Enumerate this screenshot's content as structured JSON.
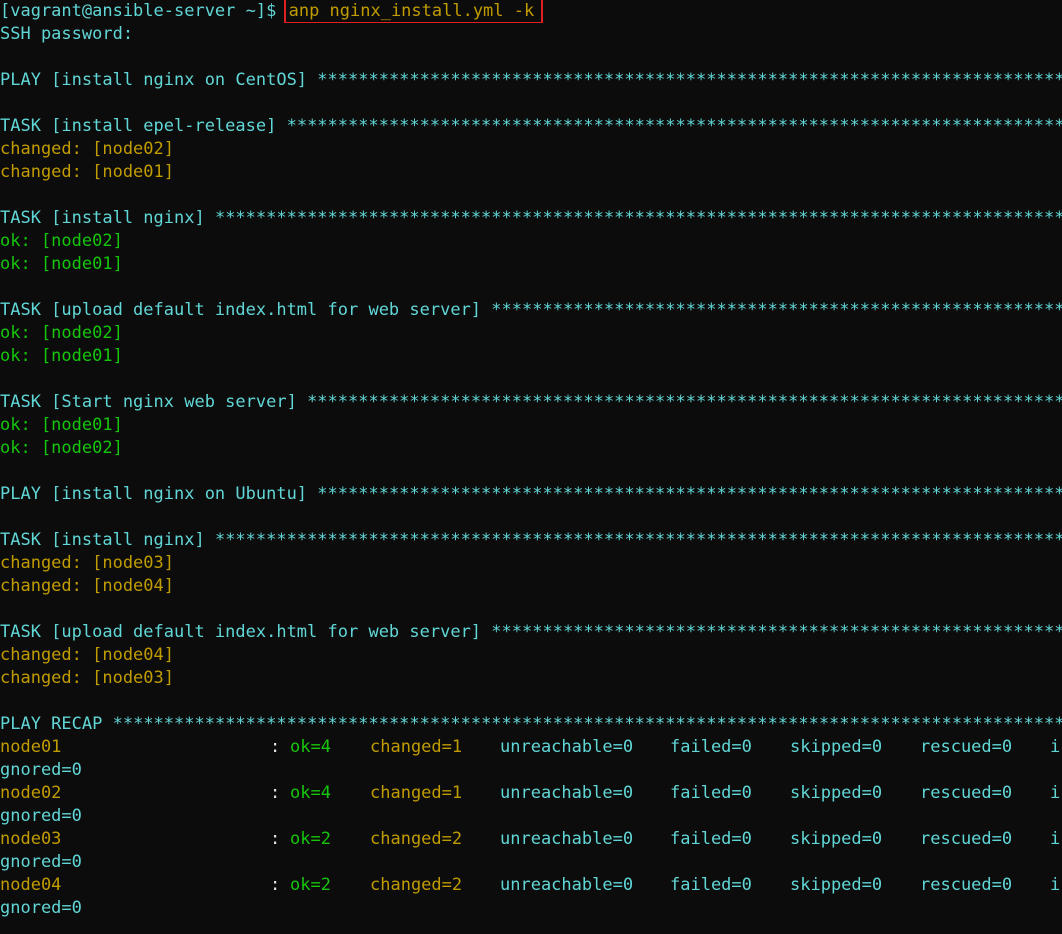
{
  "prompt": {
    "user_host": "[vagrant@ansible-server ~]$",
    "command": "anp nginx_install.yml -k"
  },
  "ssh_password": "SSH password:",
  "stars": "********************************************************************************************************",
  "plays": [
    {
      "header": "PLAY [install nginx on CentOS]",
      "tasks": [
        {
          "header": "TASK [install epel-release]",
          "results": [
            {
              "status": "changed: [node02]",
              "color": "yellow"
            },
            {
              "status": "changed: [node01]",
              "color": "yellow"
            }
          ]
        },
        {
          "header": "TASK [install nginx]",
          "results": [
            {
              "status": "ok: [node02]",
              "color": "green"
            },
            {
              "status": "ok: [node01]",
              "color": "green"
            }
          ]
        },
        {
          "header": "TASK [upload default index.html for web server]",
          "results": [
            {
              "status": "ok: [node02]",
              "color": "green"
            },
            {
              "status": "ok: [node01]",
              "color": "green"
            }
          ]
        },
        {
          "header": "TASK [Start nginx web server]",
          "results": [
            {
              "status": "ok: [node01]",
              "color": "green"
            },
            {
              "status": "ok: [node02]",
              "color": "green"
            }
          ]
        }
      ]
    },
    {
      "header": "PLAY [install nginx on Ubuntu]",
      "tasks": [
        {
          "header": "TASK [install nginx]",
          "results": [
            {
              "status": "changed: [node03]",
              "color": "yellow"
            },
            {
              "status": "changed: [node04]",
              "color": "yellow"
            }
          ]
        },
        {
          "header": "TASK [upload default index.html for web server]",
          "results": [
            {
              "status": "changed: [node04]",
              "color": "yellow"
            },
            {
              "status": "changed: [node03]",
              "color": "yellow"
            }
          ]
        }
      ]
    }
  ],
  "recap": {
    "header": "PLAY RECAP",
    "rows": [
      {
        "host": "node01",
        "host_color": "yellow",
        "ok": "ok=4",
        "changed": "changed=1",
        "unreachable": "unreachable=0",
        "failed": "failed=0",
        "skipped": "skipped=0",
        "rescued": "rescued=0",
        "ignored_head": "i",
        "ignored_tail": "gnored=0"
      },
      {
        "host": "node02",
        "host_color": "yellow",
        "ok": "ok=4",
        "changed": "changed=1",
        "unreachable": "unreachable=0",
        "failed": "failed=0",
        "skipped": "skipped=0",
        "rescued": "rescued=0",
        "ignored_head": "i",
        "ignored_tail": "gnored=0"
      },
      {
        "host": "node03",
        "host_color": "yellow",
        "ok": "ok=2",
        "changed": "changed=2",
        "unreachable": "unreachable=0",
        "failed": "failed=0",
        "skipped": "skipped=0",
        "rescued": "rescued=0",
        "ignored_head": "i",
        "ignored_tail": "gnored=0"
      },
      {
        "host": "node04",
        "host_color": "yellow",
        "ok": "ok=2",
        "changed": "changed=2",
        "unreachable": "unreachable=0",
        "failed": "failed=0",
        "skipped": "skipped=0",
        "rescued": "rescued=0",
        "ignored_head": "i",
        "ignored_tail": "gnored=0"
      }
    ]
  },
  "colors": {
    "background": "#0c0c0c",
    "cyan": "#61d6d6",
    "yellow": "#c19c00",
    "green": "#16c60c",
    "highlight_box": "#e02020"
  }
}
